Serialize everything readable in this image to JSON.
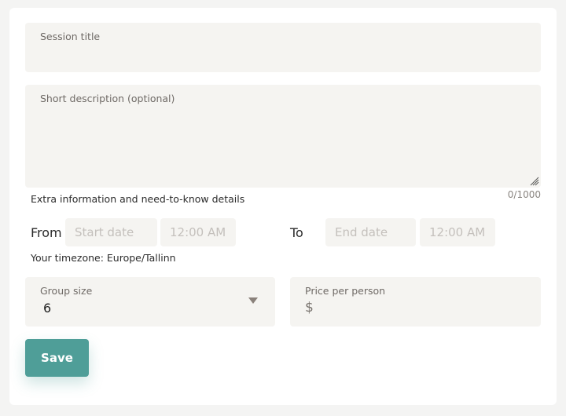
{
  "form": {
    "title_field": {
      "label": "Session title",
      "value": ""
    },
    "description_field": {
      "label": "Short description (optional)",
      "value": ""
    },
    "description_helper": "Extra information and need-to-know details",
    "description_counter": "0/1000",
    "schedule": {
      "from_label": "From",
      "to_label": "To",
      "start_date_placeholder": "Start date",
      "start_time_placeholder": "12:00 AM",
      "end_date_placeholder": "End date",
      "end_time_placeholder": "12:00 AM",
      "timezone_text": "Your timezone: Europe/Tallinn"
    },
    "group_size": {
      "label": "Group size",
      "value": "6",
      "icon": "chevron-down-icon"
    },
    "price": {
      "label": "Price per person",
      "currency": "$",
      "value": ""
    },
    "save_label": "Save"
  },
  "colors": {
    "accent": "#4f9e98",
    "field_bg": "#f5f4f1",
    "page_bg": "#f4f4f3"
  }
}
